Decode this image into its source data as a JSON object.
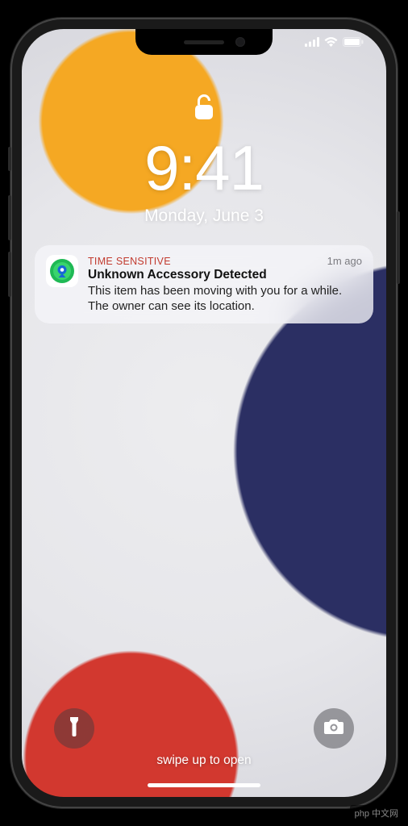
{
  "status": {
    "signal": 4,
    "wifi": 3,
    "battery": 100
  },
  "lock": {
    "time": "9:41",
    "date": "Monday, June 3"
  },
  "notification": {
    "category": "TIME SENSITIVE",
    "timestamp": "1m ago",
    "title": "Unknown Accessory Detected",
    "message": "This item has been moving with you for a while. The owner can see its location.",
    "app_icon": "find-my"
  },
  "bottom": {
    "swipe_hint": "swipe up to open"
  },
  "watermark": "php 中文网"
}
